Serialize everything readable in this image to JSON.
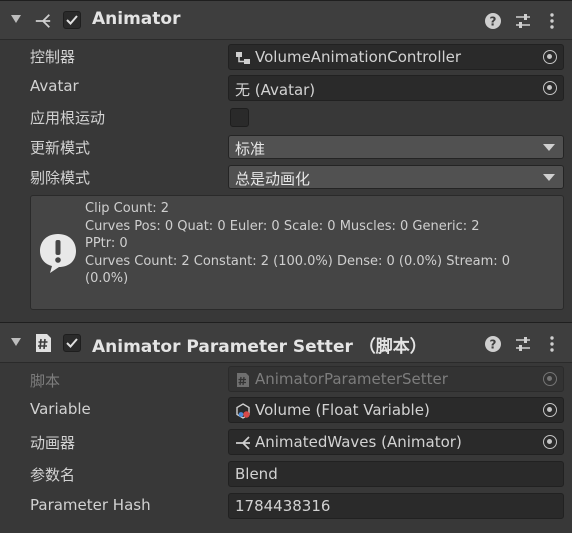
{
  "animator": {
    "title": "Animator",
    "enabled": true,
    "rows": {
      "controller": {
        "label": "控制器",
        "value": "VolumeAnimationController"
      },
      "avatar": {
        "label": "Avatar",
        "value": "无 (Avatar)"
      },
      "apply_root_motion": {
        "label": "应用根运动",
        "checked": false
      },
      "update_mode": {
        "label": "更新模式",
        "value": "标准"
      },
      "culling_mode": {
        "label": "剔除模式",
        "value": "总是动画化"
      }
    },
    "info": {
      "line1": "Clip Count: 2",
      "line2": "Curves Pos: 0 Quat: 0 Euler: 0 Scale: 0 Muscles: 0 Generic: 2",
      "line3": "PPtr: 0",
      "line4": "Curves Count: 2 Constant: 2 (100.0%) Dense: 0 (0.0%) Stream: 0",
      "line5": "(0.0%)"
    }
  },
  "setter": {
    "title": "Animator Parameter Setter",
    "title_suffix": "（脚本）",
    "enabled": true,
    "rows": {
      "script": {
        "label": "脚本",
        "value": "AnimatorParameterSetter"
      },
      "variable": {
        "label": "Variable",
        "value": "Volume (Float Variable)"
      },
      "animator": {
        "label": "动画器",
        "value": "AnimatedWaves (Animator)"
      },
      "parameter_name": {
        "label": "参数名",
        "value": "Blend"
      },
      "parameter_hash": {
        "label": "Parameter Hash",
        "value": "1784438316"
      }
    }
  },
  "colors": {
    "panel_bg": "#383838",
    "header_bg": "#3e3e3e",
    "field_bg": "#2a2a2a",
    "popup_bg": "#515151",
    "text": "#d2d2d2",
    "disabled_text": "#7d7d7d"
  },
  "icons": {
    "foldout": "triangle-down-icon",
    "animator": "animator-icon",
    "script": "script-hash-icon",
    "help": "help-icon",
    "presets": "presets-icon",
    "menu": "kebab-menu-icon",
    "object_picker": "object-picker-icon",
    "warning": "warning-speech-icon"
  }
}
